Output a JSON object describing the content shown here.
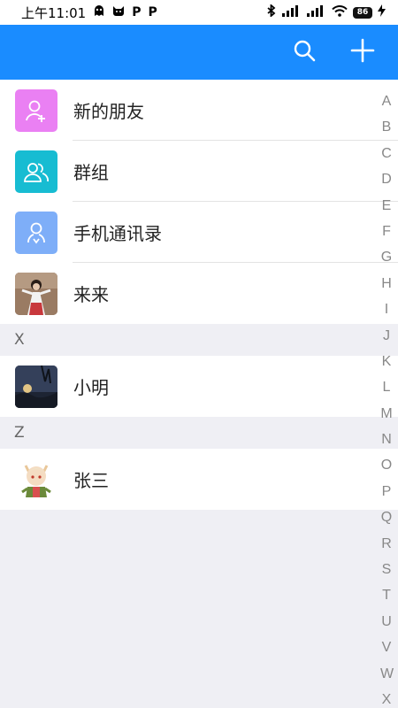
{
  "status_bar": {
    "time": "上午11:01",
    "left_glyphs": [
      "P",
      "P"
    ],
    "battery": "86"
  },
  "header": {
    "search_icon": "search-icon",
    "add_icon": "plus-icon",
    "background": "#1a8cff"
  },
  "top_items": [
    {
      "label": "新的朋友",
      "icon": "new-friend-icon",
      "color": "#ea80f3"
    },
    {
      "label": "群组",
      "icon": "group-icon",
      "color": "#17bcd2"
    },
    {
      "label": "手机通讯录",
      "icon": "phone-contacts-icon",
      "color": "#7eaef8"
    }
  ],
  "contacts_ungrouped": [
    {
      "name": "来来",
      "avatar": "photo-avatar"
    }
  ],
  "sections": [
    {
      "letter": "X",
      "contacts": [
        {
          "name": "小明",
          "avatar": "photo-avatar"
        }
      ]
    },
    {
      "letter": "Z",
      "contacts": [
        {
          "name": "张三",
          "avatar": "anime-avatar"
        }
      ]
    }
  ],
  "alphabet_index": [
    "A",
    "B",
    "C",
    "D",
    "E",
    "F",
    "G",
    "H",
    "I",
    "J",
    "K",
    "L",
    "M",
    "N",
    "O",
    "P",
    "Q",
    "R",
    "S",
    "T",
    "U",
    "V",
    "W",
    "X"
  ]
}
